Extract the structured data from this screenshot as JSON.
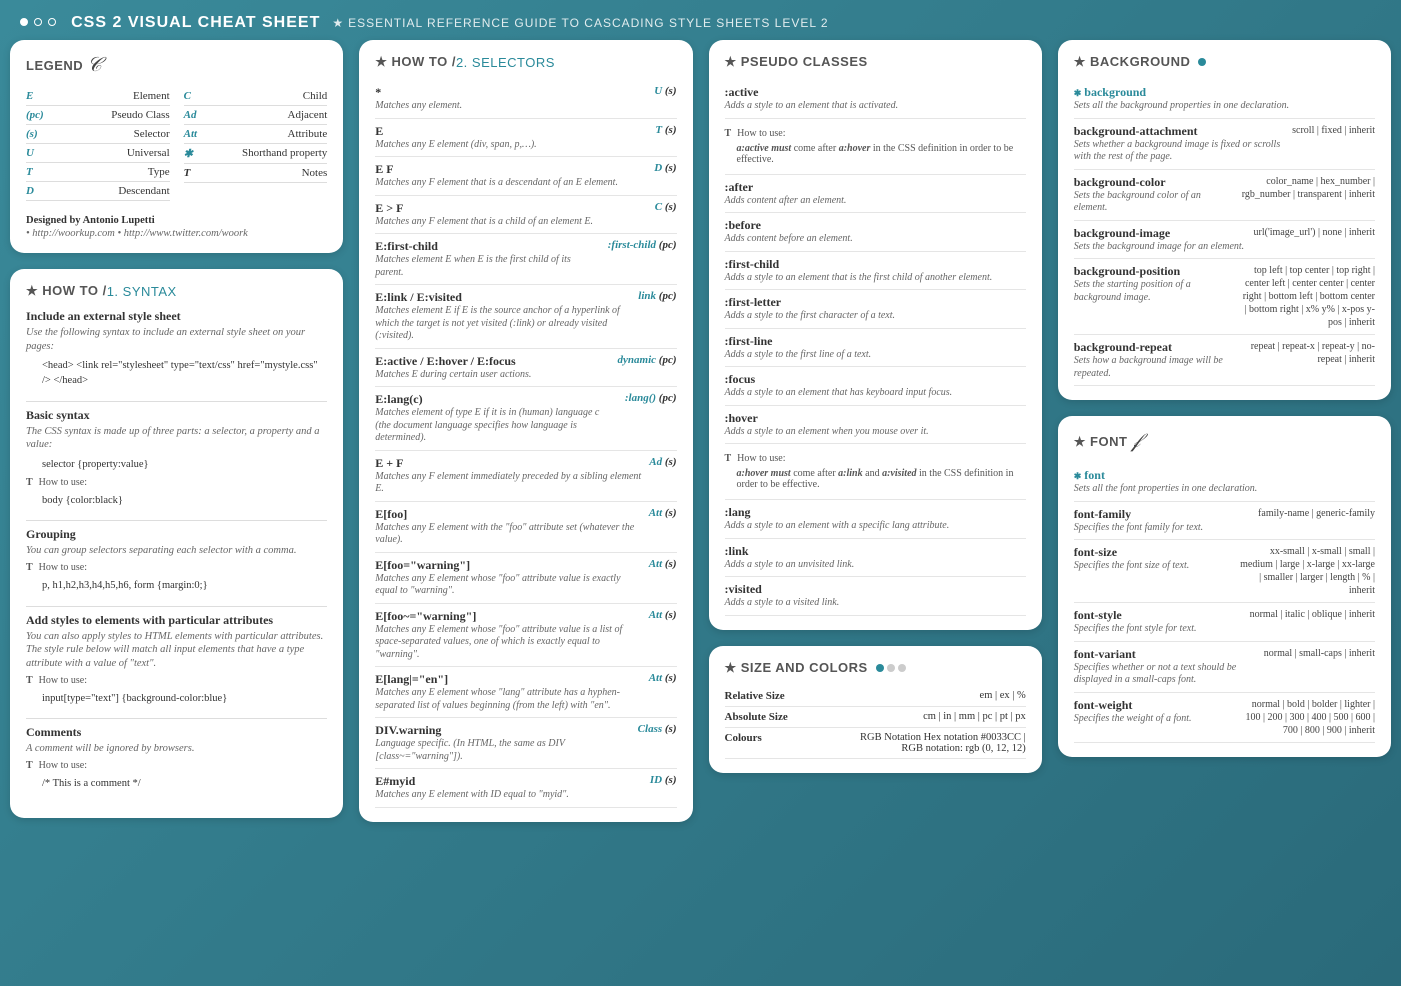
{
  "header": {
    "title": "CSS 2 VISUAL CHEAT SHEET",
    "subtitle": "ESSENTIAL REFERENCE GUIDE TO CASCADING STYLE SHEETS LEVEL 2"
  },
  "legend": {
    "title": "LEGEND",
    "left": [
      {
        "k": "E",
        "v": "Element"
      },
      {
        "k": "(pc)",
        "v": "Pseudo Class"
      },
      {
        "k": "(s)",
        "v": "Selector"
      },
      {
        "k": "U",
        "v": "Universal"
      },
      {
        "k": "T",
        "v": "Type"
      },
      {
        "k": "D",
        "v": "Descendant"
      }
    ],
    "right": [
      {
        "k": "C",
        "v": "Child"
      },
      {
        "k": "Ad",
        "v": "Adjacent"
      },
      {
        "k": "Att",
        "v": "Attribute"
      },
      {
        "k": "✱",
        "v": "Shorthand property"
      },
      {
        "k": "T",
        "v": "Notes",
        "dark": true
      }
    ],
    "credit_title": "Designed by Antonio Lupetti",
    "credit_links": "• http://woorkup.com • http://www.twitter.com/woork"
  },
  "howto1": {
    "title_prefix": "★ HOW TO / ",
    "title_num": "1. SYNTAX",
    "sections": [
      {
        "title": "Include an external style sheet",
        "desc": "Use the following syntax to include an external style sheet on your pages:",
        "code": "<head>\n<link rel=\"stylesheet\" type=\"text/css\" href=\"mystyle.css\" />\n</head>"
      },
      {
        "title": "Basic syntax",
        "desc": "The CSS syntax is made up of three parts: a selector, a property and a value:",
        "code": "selector {property:value}",
        "howto": "body {color:black}"
      },
      {
        "title": "Grouping",
        "desc": "You can group selectors separating each selector with a comma.",
        "howto": "p, h1,h2,h3,h4,h5,h6, form {margin:0;}"
      },
      {
        "title": "Add styles to elements with particular attributes",
        "desc": "You can also apply styles to HTML elements with particular attributes. The style rule below will match all input elements that have a type attribute with a value of \"text\".",
        "howto": "input[type=\"text\"] {background-color:blue}"
      },
      {
        "title": "Comments",
        "desc": "A comment will be ignored by browsers.",
        "howto": "/* This is a comment */"
      }
    ]
  },
  "howto2": {
    "title_prefix": "★ HOW TO / ",
    "title_num": "2. SELECTORS",
    "items": [
      {
        "name": "*",
        "desc": "Matches any element.",
        "type": "U",
        "paren": "(s)"
      },
      {
        "name": "E",
        "desc": "Matches any E element (div, span, p,…).",
        "type": "T",
        "paren": "(s)"
      },
      {
        "name": "E F",
        "desc": "Matches any F element that is a descendant of an E element.",
        "type": "D",
        "paren": "(s)"
      },
      {
        "name": "E > F",
        "desc": "Matches any F element that is a child of an element E.",
        "type": "C",
        "paren": "(s)"
      },
      {
        "name": "E:first-child",
        "desc": "Matches element E when E is the first child of its parent.",
        "type": ":first-child",
        "paren": "(pc)"
      },
      {
        "name": "E:link / E:visited",
        "desc": "Matches element E if E is the source anchor of a hyperlink of which the target is not yet visited (:link) or already visited (:visited).",
        "type": "link",
        "paren": "(pc)"
      },
      {
        "name": "E:active / E:hover / E:focus",
        "desc": "Matches E during certain user actions.",
        "type": "dynamic",
        "paren": "(pc)"
      },
      {
        "name": "E:lang(c)",
        "desc": "Matches element of type E if it is in (human) language c (the document language specifies how language is determined).",
        "type": ":lang()",
        "paren": "(pc)"
      },
      {
        "name": "E + F",
        "desc": "Matches any F element immediately preceded by a sibling element E.",
        "type": "Ad",
        "paren": "(s)"
      },
      {
        "name": "E[foo]",
        "desc": "Matches any E element with the \"foo\" attribute set (whatever the value).",
        "type": "Att",
        "paren": "(s)"
      },
      {
        "name": "E[foo=\"warning\"]",
        "desc": "Matches any E element whose \"foo\" attribute value is exactly equal to \"warning\".",
        "type": "Att",
        "paren": "(s)"
      },
      {
        "name": "E[foo~=\"warning\"]",
        "desc": "Matches any E element whose \"foo\" attribute value is a list of space-separated values, one of which is exactly equal to \"warning\".",
        "type": "Att",
        "paren": "(s)"
      },
      {
        "name": "E[lang|=\"en\"]",
        "desc": "Matches any E element whose \"lang\" attribute has a hyphen-separated list of values beginning (from the left) with \"en\".",
        "type": "Att",
        "paren": "(s)"
      },
      {
        "name": "DIV.warning",
        "desc": "Language specific. (In HTML, the same as DIV [class~=\"warning\"]).",
        "type": "Class",
        "paren": "(s)"
      },
      {
        "name": "E#myid",
        "desc": "Matches any E element with ID equal to \"myid\".",
        "type": "ID",
        "paren": "(s)"
      }
    ]
  },
  "pseudo": {
    "title": "★ PSEUDO CLASSES",
    "items": [
      {
        "name": ":active",
        "desc": "Adds a style to an element that is activated.",
        "note": "a:active must come after a:hover in the CSS definition in order to be effective."
      },
      {
        "name": ":after",
        "desc": "Adds content after an element."
      },
      {
        "name": ":before",
        "desc": "Adds content before an element."
      },
      {
        "name": ":first-child",
        "desc": "Adds a style to an element that is the first child of another element."
      },
      {
        "name": ":first-letter",
        "desc": "Adds a style to the first character of a text."
      },
      {
        "name": ":first-line",
        "desc": "Adds a style to the first line of a text."
      },
      {
        "name": ":focus",
        "desc": "Adds a style to an element that has keyboard input focus."
      },
      {
        "name": ":hover",
        "desc": "Adds a style to an element when you mouse over it.",
        "note": "a:hover must come after a:link and a:visited in the CSS definition in order to be effective."
      },
      {
        "name": ":lang",
        "desc": "Adds a style to an element with a specific lang attribute."
      },
      {
        "name": ":link",
        "desc": "Adds a style to an unvisited link."
      },
      {
        "name": ":visited",
        "desc": "Adds a style to a visited link."
      }
    ]
  },
  "size": {
    "title": "★ SIZE AND COLORS",
    "rows": [
      {
        "label": "Relative Size",
        "values": "em | ex | %"
      },
      {
        "label": "Absolute Size",
        "values": "cm | in | mm | pc | pt | px"
      },
      {
        "label": "Colours",
        "values": "RGB Notation Hex notation #0033CC |\nRGB notation: rgb (0, 12, 12)"
      }
    ]
  },
  "background": {
    "title": "★ BACKGROUND",
    "items": [
      {
        "name": "background",
        "teal": true,
        "desc": "Sets all the background properties in one declaration."
      },
      {
        "name": "background-attachment",
        "desc": "Sets whether a background image is fixed or scrolls with the rest of the page.",
        "vals": "scroll | fixed | inherit"
      },
      {
        "name": "background-color",
        "desc": "Sets the background color of an element.",
        "vals": "color_name | hex_number | rgb_number | transparent | inherit"
      },
      {
        "name": "background-image",
        "desc": "Sets the background image for an element.",
        "vals": "url('image_url') | none | inherit"
      },
      {
        "name": "background-position",
        "desc": "Sets the starting position of a background image.",
        "vals": "top left | top center | top right | center left | center center | center right | bottom left | bottom center | bottom right | x% y% | x-pos y-pos | inherit"
      },
      {
        "name": "background-repeat",
        "desc": "Sets how a background image will be repeated.",
        "vals": "repeat | repeat-x | repeat-y | no-repeat | inherit"
      }
    ]
  },
  "font": {
    "title": "★ FONT",
    "items": [
      {
        "name": "font",
        "teal": true,
        "desc": "Sets all the font properties in one declaration."
      },
      {
        "name": "font-family",
        "desc": "Specifies the font family for text.",
        "vals": "family-name | generic-family"
      },
      {
        "name": "font-size",
        "desc": "Specifies the font size of text.",
        "vals": "xx-small | x-small | small | medium | large | x-large | xx-large | smaller | larger | length | % | inherit"
      },
      {
        "name": "font-style",
        "desc": "Specifies the font style for text.",
        "vals": "normal | italic | oblique | inherit"
      },
      {
        "name": "font-variant",
        "desc": "Specifies whether or not a text should be displayed in a small-caps font.",
        "vals": "normal | small-caps | inherit"
      },
      {
        "name": "font-weight",
        "desc": "Specifies the weight of a font.",
        "vals": "normal | bold | bolder | lighter | 100 | 200 | 300 | 400 | 500 | 600 | 700 | 800 | 900 | inherit"
      }
    ]
  }
}
